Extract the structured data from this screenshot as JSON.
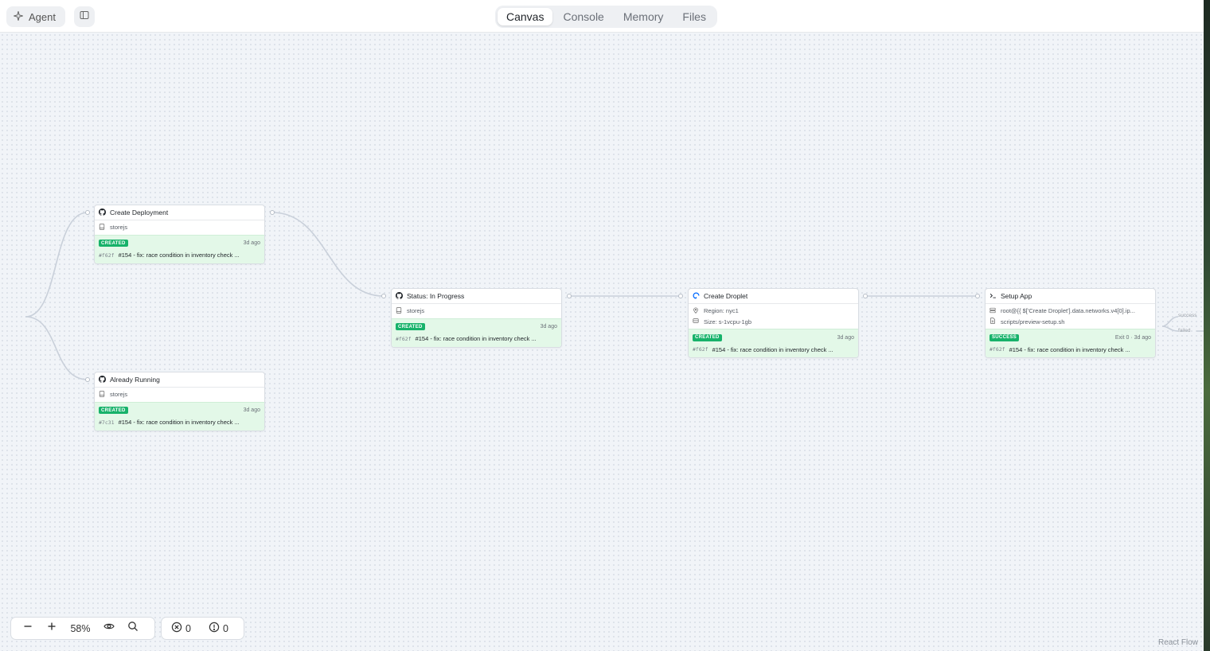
{
  "header": {
    "agent_label": "Agent",
    "tabs": [
      {
        "label": "Canvas",
        "active": true
      },
      {
        "label": "Console",
        "active": false
      },
      {
        "label": "Memory",
        "active": false
      },
      {
        "label": "Files",
        "active": false
      }
    ]
  },
  "nodes": {
    "create_deployment": {
      "title": "Create Deployment",
      "icon": "github-icon",
      "meta": [
        "storejs"
      ],
      "badge": "CREATED",
      "time": "3d ago",
      "hash": "#f62f",
      "message": "#154 - fix: race condition in inventory check ..."
    },
    "already_running": {
      "title": "Already Running",
      "icon": "github-icon",
      "meta": [
        "storejs"
      ],
      "badge": "CREATED",
      "time": "3d ago",
      "hash": "#7c31",
      "message": "#154 - fix: race condition in inventory check ..."
    },
    "status_in_progress": {
      "title": "Status: In Progress",
      "icon": "github-icon",
      "meta": [
        "storejs"
      ],
      "badge": "CREATED",
      "time": "3d ago",
      "hash": "#f62f",
      "message": "#154 - fix: race condition in inventory check ..."
    },
    "create_droplet": {
      "title": "Create Droplet",
      "icon": "digitalocean-icon",
      "meta": [
        "Region: nyc1",
        "Size: s-1vcpu-1gb"
      ],
      "badge": "CREATED",
      "time": "3d ago",
      "hash": "#f62f",
      "message": "#154 - fix: race condition in inventory check ..."
    },
    "setup_app": {
      "title": "Setup App",
      "icon": "terminal-icon",
      "meta": [
        "root@{{ $['Create Droplet'].data.networks.v4[0].ip...",
        "scripts/preview-setup.sh"
      ],
      "badge": "SUCCESS",
      "time": "Exit 0 · 3d ago",
      "hash": "#f62f",
      "message": "#154 - fix: race condition in inventory check ..."
    }
  },
  "edge_labels": {
    "success": "success",
    "failed": "failed"
  },
  "controls": {
    "zoom": "58%"
  },
  "issues": {
    "errors": "0",
    "warnings": "0"
  },
  "attribution": "React Flow",
  "colors": {
    "badge": "#17b26a",
    "status_bg": "#e3f8e8",
    "canvas": "#f1f4f8"
  }
}
